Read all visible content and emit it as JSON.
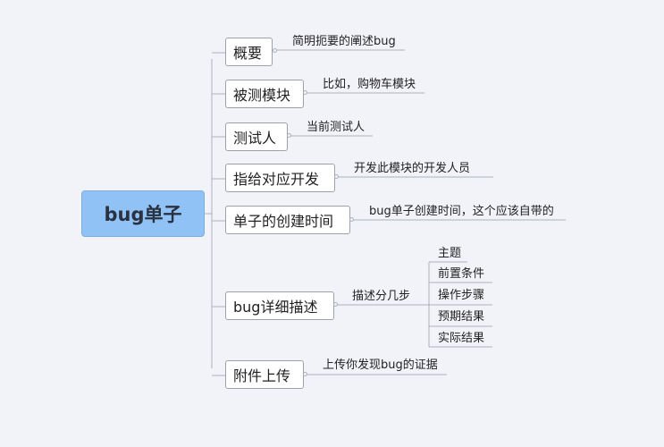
{
  "root": {
    "label": "bug单子"
  },
  "branches": [
    {
      "label": "概要",
      "desc": "简明扼要的阐述bug"
    },
    {
      "label": "被测模块",
      "desc": "比如，购物车模块"
    },
    {
      "label": "测试人",
      "desc": "当前测试人"
    },
    {
      "label": "指给对应开发",
      "desc": "开发此模块的开发人员"
    },
    {
      "label": "单子的创建时间",
      "desc": "bug单子创建时间，这个应该自带的"
    },
    {
      "label": "bug详细描述",
      "desc": "描述分几步",
      "children": [
        "主题",
        "前置条件",
        "操作步骤",
        "预期结果",
        "实际结果"
      ]
    },
    {
      "label": "附件上传",
      "desc": "上传你发现bug的证据"
    }
  ]
}
